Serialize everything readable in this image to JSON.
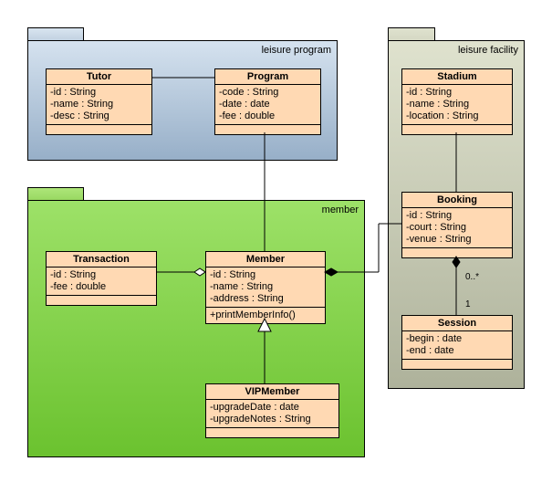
{
  "packages": {
    "program": {
      "label": "leisure program"
    },
    "member": {
      "label": "member"
    },
    "facility": {
      "label": "leisure facility"
    }
  },
  "classes": {
    "tutor": {
      "name": "Tutor",
      "attrs": [
        "-id : String",
        "-name : String",
        "-desc : String"
      ]
    },
    "program": {
      "name": "Program",
      "attrs": [
        "-code : String",
        "-date : date",
        "-fee : double"
      ]
    },
    "transaction": {
      "name": "Transaction",
      "attrs": [
        "-id : String",
        "-fee : double"
      ]
    },
    "member": {
      "name": "Member",
      "attrs": [
        "-id : String",
        "-name : String",
        "-address : String"
      ],
      "ops": [
        "+printMemberInfo()"
      ]
    },
    "vipmember": {
      "name": "VIPMember",
      "attrs": [
        "-upgradeDate : date",
        "-upgradeNotes : String"
      ]
    },
    "stadium": {
      "name": "Stadium",
      "attrs": [
        "-id : String",
        "-name : String",
        "-location : String"
      ]
    },
    "booking": {
      "name": "Booking",
      "attrs": [
        "-id : String",
        "-court : String",
        "-venue : String"
      ]
    },
    "session": {
      "name": "Session",
      "attrs": [
        "-begin : date",
        "-end : date"
      ]
    }
  },
  "mult": {
    "bookSess1": "0..*",
    "bookSess2": "1"
  }
}
